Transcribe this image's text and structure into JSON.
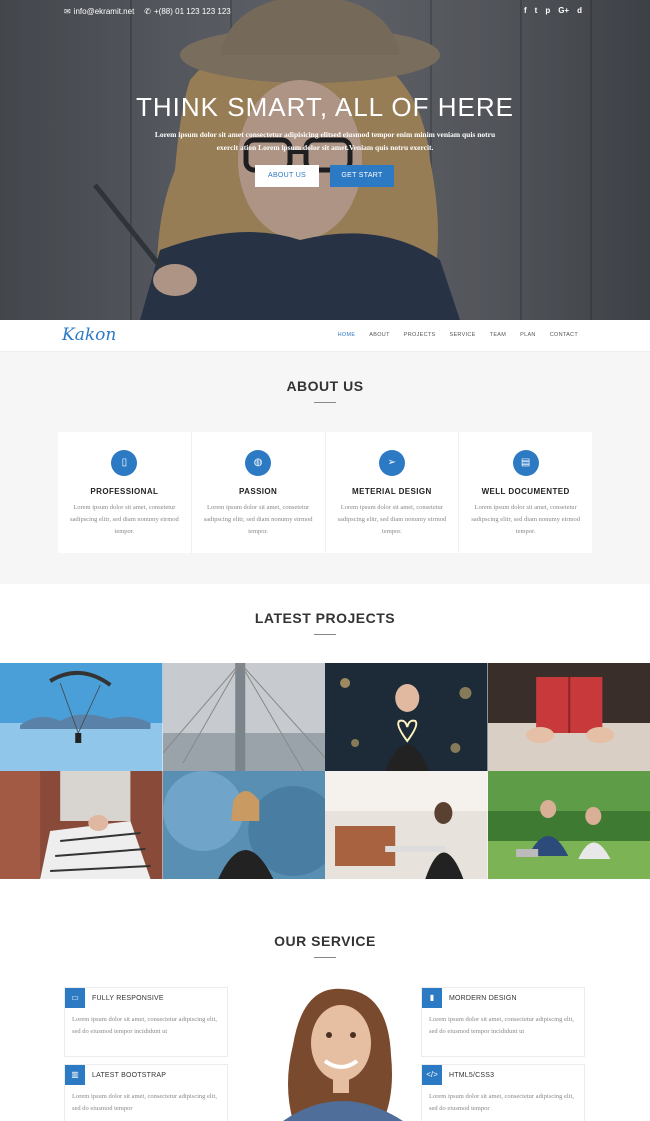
{
  "topbar": {
    "email": "info@ekramit.net",
    "phone": "+(88) 01 123 123 123",
    "social": [
      "f",
      "t",
      "p",
      "G+",
      "d"
    ]
  },
  "hero": {
    "title": "THINK SMART, ALL OF HERE",
    "subtitle": "Lorem ipsum dolor sit amet consectetur adipisicing elitsed eiusmod tempor enim minim veniam quis notru exercit ation Lorem ipsum dolor sit amet.Veniam quis notru exercit.",
    "about_button": "ABOUT US",
    "start_button": "GET START"
  },
  "nav": {
    "logo": "Kakon",
    "items": [
      "HOME",
      "ABOUT",
      "PROJECTS",
      "SERVICE",
      "TEAM",
      "PLAN",
      "CONTACT"
    ],
    "active_index": 0
  },
  "about": {
    "title": "ABOUT US",
    "cards": [
      {
        "icon": "mobile-icon",
        "title": "PROFESSIONAL",
        "text": "Lorem ipsum dolor sit amet, consetetur sadipscing elitr, sed diam nonumy eirmod tempor."
      },
      {
        "icon": "globe-icon",
        "title": "PASSION",
        "text": "Lorem ipsum dolor sit amet, consetetur sadipscing elitr, sed diam nonumy eirmod tempor."
      },
      {
        "icon": "paper-plane-icon",
        "title": "METERIAL DESIGN",
        "text": "Lorem ipsum dolor sit amet, consetetur sadipscing elitr, sed diam nonumy eirmod tempor."
      },
      {
        "icon": "document-icon",
        "title": "WELL DOCUMENTED",
        "text": "Lorem ipsum dolor sit amet, consetetur sadipscing elitr, sed diam nonumy eirmod tempor."
      }
    ]
  },
  "projects": {
    "title": "LATEST PROJECTS"
  },
  "service": {
    "title": "OUR SERVICE",
    "items": [
      {
        "icon": "monitor-icon",
        "name": "FULLY RESPONSIVE",
        "text": "Lorem ipsum dolor sit amet, consectetur adipiscing elit, sed do eiusmod tempor incididunt ut"
      },
      {
        "icon": "book-icon",
        "name": "LATEST BOOTSTRAP",
        "text": "Lorem ipsum dolor sit amet, consectetur adipiscing elit, sed do eiusmod tempor"
      },
      {
        "icon": "bar-chart-icon",
        "name": "MORDERN DESIGN",
        "text": "Lorem ipsum dolor sit amet, consectetur adipiscing elit, sed do eiusmod tempor incididunt ut"
      },
      {
        "icon": "code-icon",
        "name": "HTML5/CSS3",
        "text": "Lorem ipsum dolor sit amet, consectetur adipiscing elit, sed do eiusmod tempor"
      }
    ]
  },
  "colors": {
    "accent": "#2c7ac4",
    "section_bg": "#f6f6f6"
  }
}
